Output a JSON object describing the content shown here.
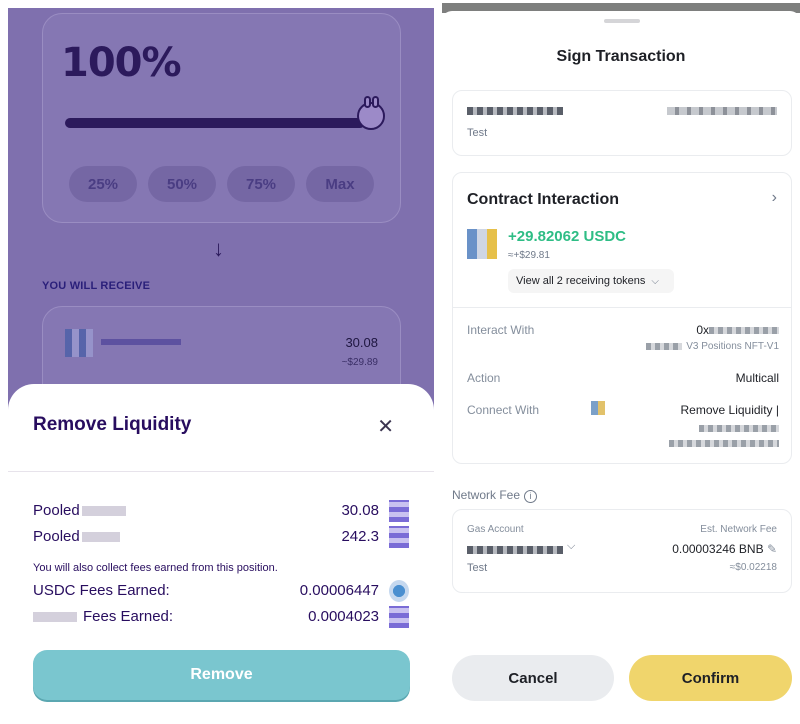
{
  "left": {
    "percent_value": "100%",
    "slider_fraction": 1.0,
    "percent_buttons": [
      "25%",
      "50%",
      "75%",
      "Max"
    ],
    "receive_label": "YOU WILL RECEIVE",
    "receive_item": {
      "amount": "30.08",
      "usd": "~$29.89"
    },
    "modal": {
      "title": "Remove Liquidity",
      "close_glyph": "✕",
      "rows": [
        {
          "label": "Pooled",
          "value": "30.08"
        },
        {
          "label": "Pooled",
          "value": "242.3"
        }
      ],
      "note": "You will also collect fees earned from this position.",
      "fees": [
        {
          "label": "USDC Fees Earned:",
          "value": "0.00006447"
        },
        {
          "label": "Fees Earned:",
          "value": "0.0004023"
        }
      ],
      "remove_label": "Remove"
    }
  },
  "right": {
    "title": "Sign Transaction",
    "account_sub": "Test",
    "contract": {
      "title": "Contract Interaction",
      "token_amount": "+29.82062 USDC",
      "token_usd": "≈+$29.81",
      "view_tokens": "View all 2 receiving tokens",
      "interact_with_label": "Interact With",
      "interact_with_value": "0x",
      "interact_with_sub": "V3 Positions NFT-V1",
      "action_label": "Action",
      "action_value": "Multicall",
      "connect_with_label": "Connect With",
      "connect_with_value": "Remove Liquidity |"
    },
    "network_fee_label": "Network Fee",
    "fee": {
      "gas_account_label": "Gas Account",
      "est_fee_label": "Est. Network Fee",
      "fee_value": "0.00003246 BNB",
      "fee_usd": "≈$0.02218",
      "account_sub": "Test"
    },
    "cancel_label": "Cancel",
    "confirm_label": "Confirm"
  }
}
